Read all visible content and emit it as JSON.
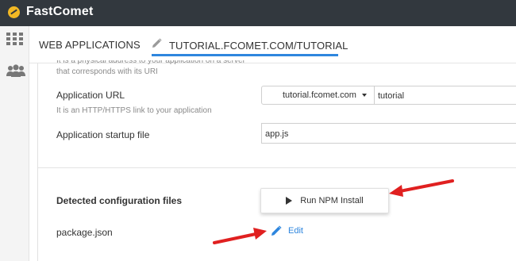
{
  "app": {
    "brand": "FastComet"
  },
  "colors": {
    "topbar": "#32383e",
    "accent": "#2e86de",
    "brand_icon": "#f2b824",
    "annotation_arrow": "#e02020"
  },
  "rail": {
    "icons": [
      "grid-icon",
      "users-icon"
    ]
  },
  "tabs": {
    "web_applications": "WEB APPLICATIONS",
    "current": "TUTORIAL.FCOMET.COM/TUTORIAL",
    "current_icon": "pencil-icon"
  },
  "form": {
    "truncated_help_line1": "It is a physical address to your application on a server",
    "truncated_help_line2": "that corresponds with its URI",
    "app_url": {
      "label": "Application URL",
      "help": "It is an HTTP/HTTPS link to your application",
      "domain": "tutorial.fcomet.com",
      "path": "tutorial"
    },
    "startup_file": {
      "label": "Application startup file",
      "value": "app.js"
    },
    "config_files": {
      "label": "Detected configuration files",
      "npm_button": "Run NPM Install",
      "file_name": "package.json",
      "edit_label": "Edit"
    }
  }
}
